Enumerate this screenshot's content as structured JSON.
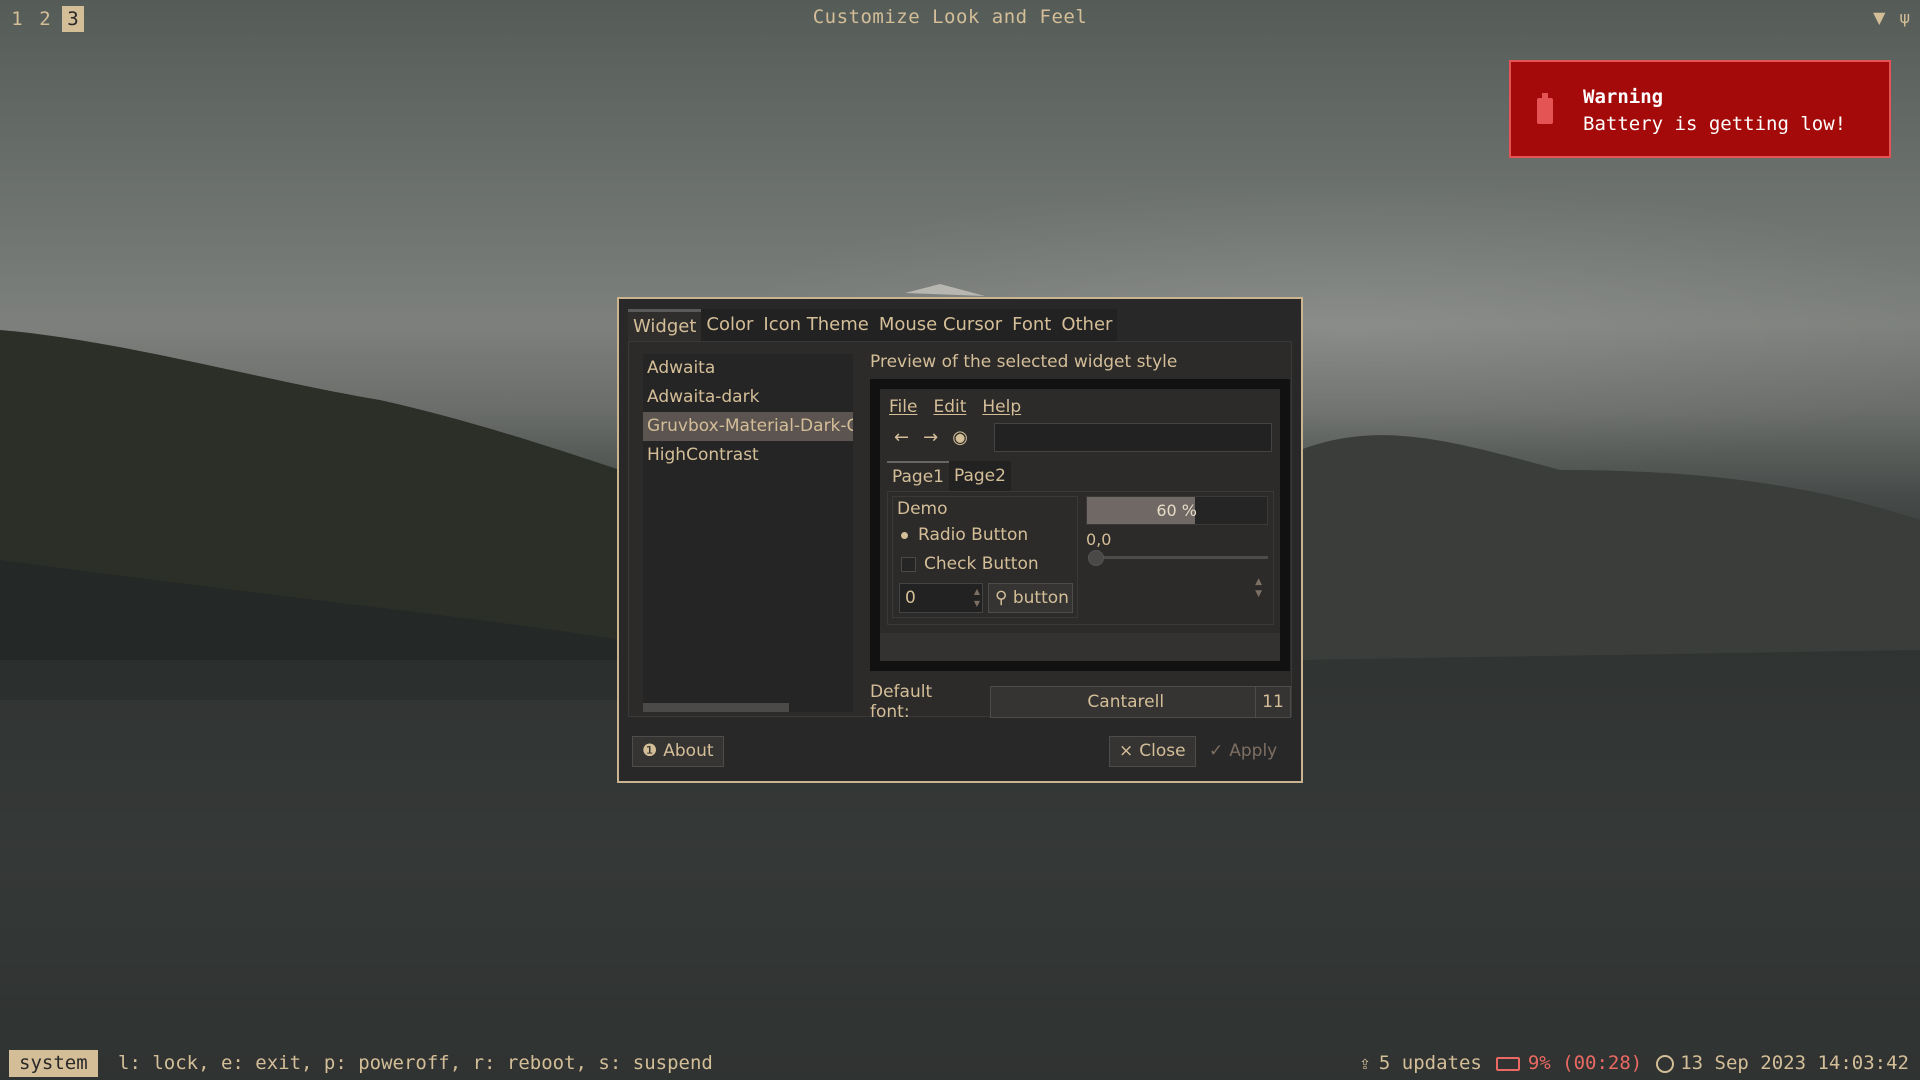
{
  "topbar": {
    "workspaces": [
      "1",
      "2",
      "3"
    ],
    "active_workspace": "3",
    "window_title": "Customize Look and Feel",
    "tray_icons": [
      "wifi-icon",
      "usb-icon"
    ]
  },
  "notification": {
    "title": "Warning",
    "message": "Battery is getting low!",
    "icon": "battery-alert-icon",
    "color": "#a40a0a"
  },
  "dialog": {
    "tabs": [
      "Widget",
      "Color",
      "Icon Theme",
      "Mouse Cursor",
      "Font",
      "Other"
    ],
    "active_tab": "Widget",
    "themes": [
      "Adwaita",
      "Adwaita-dark",
      "Gruvbox-Material-Dark-C",
      "HighContrast"
    ],
    "selected_theme": "Gruvbox-Material-Dark-C",
    "preview_label": "Preview of the selected widget style",
    "preview": {
      "menu": [
        "File",
        "Edit",
        "Help"
      ],
      "toolbar_icons": [
        "back-arrow-icon",
        "forward-arrow-icon",
        "record-icon"
      ],
      "tabs": [
        "Page1",
        "Page2"
      ],
      "demo_label": "Demo",
      "radio_label": "Radio Button",
      "check_label": "Check Button",
      "spin_value": "0",
      "button_label": "button",
      "progress_text": "60 %",
      "progress_value": 0.6,
      "scale_value": "0,0"
    },
    "default_font_label": "Default font:",
    "font_name": "Cantarell",
    "font_size": "11",
    "about_label": "About",
    "close_label": "Close",
    "apply_label": "Apply"
  },
  "bottombar": {
    "mode": "system",
    "mode_help": "l: lock, e: exit, p: poweroff, r: reboot, s: suspend",
    "updates": "5 updates",
    "battery": "9% (00:28)",
    "datetime": "13 Sep 2023 14:03:42"
  },
  "colors": {
    "foreground": "#d4be98",
    "warning": "#ea6962",
    "selection": "#5c5450"
  }
}
